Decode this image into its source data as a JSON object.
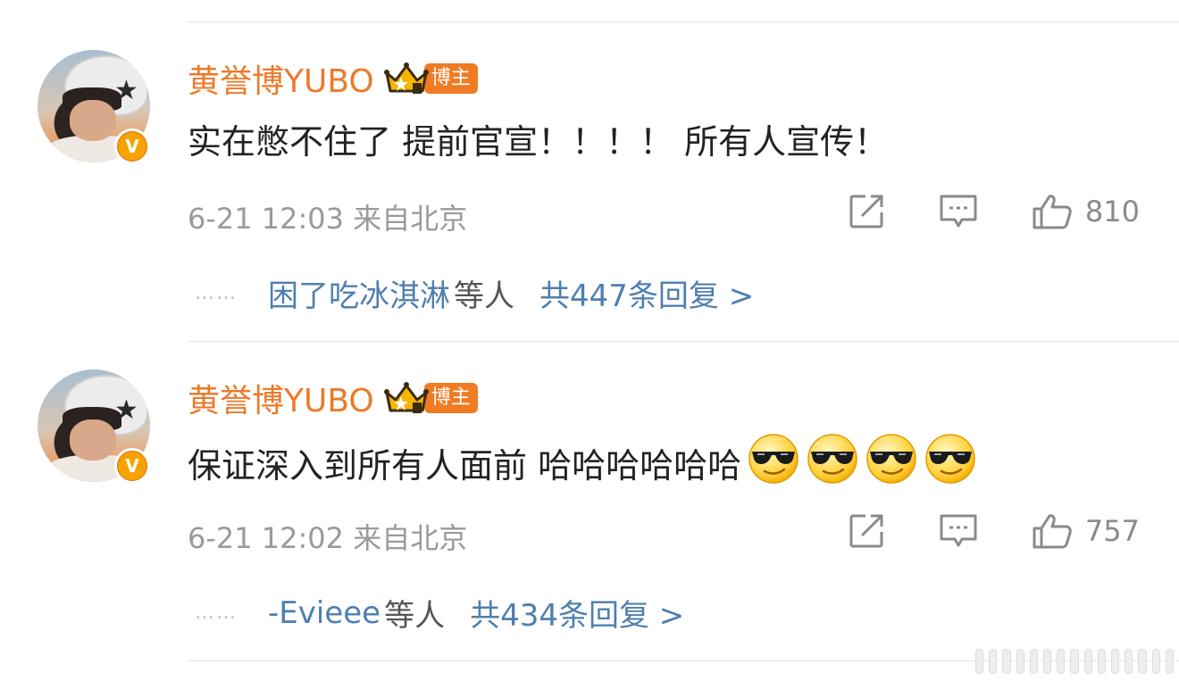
{
  "comments": [
    {
      "username": "黄誉博YUBO",
      "role_badge": "博主",
      "verified_label": "V",
      "text": "实在憋不住了 提前官宣！！！！ 所有人宣传！",
      "emoji_count": 0,
      "time": "6-21 12:03",
      "location": "来自北京",
      "likes": "810",
      "replies": {
        "dots": "……",
        "first_replier": "困了吃冰淇淋",
        "etc": "等人",
        "link": "共447条回复 >"
      }
    },
    {
      "username": "黄誉博YUBO",
      "role_badge": "博主",
      "verified_label": "V",
      "text": "保证深入到所有人面前 哈哈哈哈哈哈",
      "emoji_count": 4,
      "emoji_icon": "cool-sunglasses-emoji",
      "time": "6-21 12:02",
      "location": "来自北京",
      "likes": "757",
      "replies": {
        "dots": "……",
        "first_replier": "-Evieee",
        "etc": "等人",
        "link": "共434条回复 >"
      }
    }
  ],
  "icons": {
    "repost": "repost-icon",
    "comment": "comment-icon",
    "like": "thumbs-up-icon",
    "crown": "crown-level-icon"
  },
  "colors": {
    "username": "#ec7a2a",
    "badge": "#f07b23",
    "link": "#4f7fb0",
    "meta": "#9a9a9a",
    "verified": "#f6a200"
  }
}
